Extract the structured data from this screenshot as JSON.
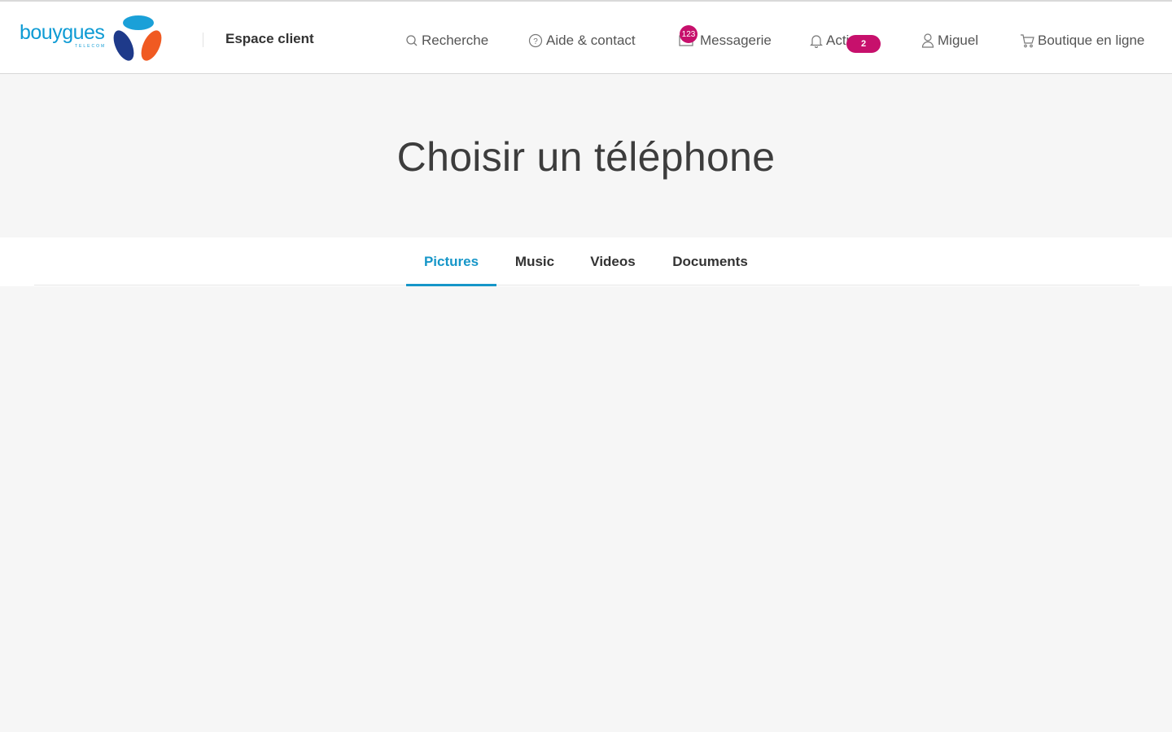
{
  "header": {
    "logo_text": "bouygues",
    "logo_subtext": "TELECOM",
    "section_title": "Espace client",
    "nav": [
      {
        "label": "Recherche",
        "icon": "search-icon"
      },
      {
        "label": "Aide & contact",
        "icon": "help-icon"
      },
      {
        "label": "Messagerie",
        "icon": "mail-icon",
        "badge": "123"
      },
      {
        "label": "Actions",
        "icon": "bell-icon",
        "badge": "2"
      },
      {
        "label": "Miguel",
        "icon": "user-icon"
      },
      {
        "label": "Boutique en ligne",
        "icon": "cart-icon"
      }
    ]
  },
  "page": {
    "title": "Choisir un téléphone"
  },
  "tabs": [
    {
      "label": "Pictures",
      "active": true
    },
    {
      "label": "Music",
      "active": false
    },
    {
      "label": "Videos",
      "active": false
    },
    {
      "label": "Documents",
      "active": false
    }
  ],
  "colors": {
    "accent": "#1696c8",
    "badge": "#c7106c",
    "logo_blue": "#0e9bd4",
    "logo_navy": "#1e3a8a",
    "logo_orange": "#f05a22"
  }
}
